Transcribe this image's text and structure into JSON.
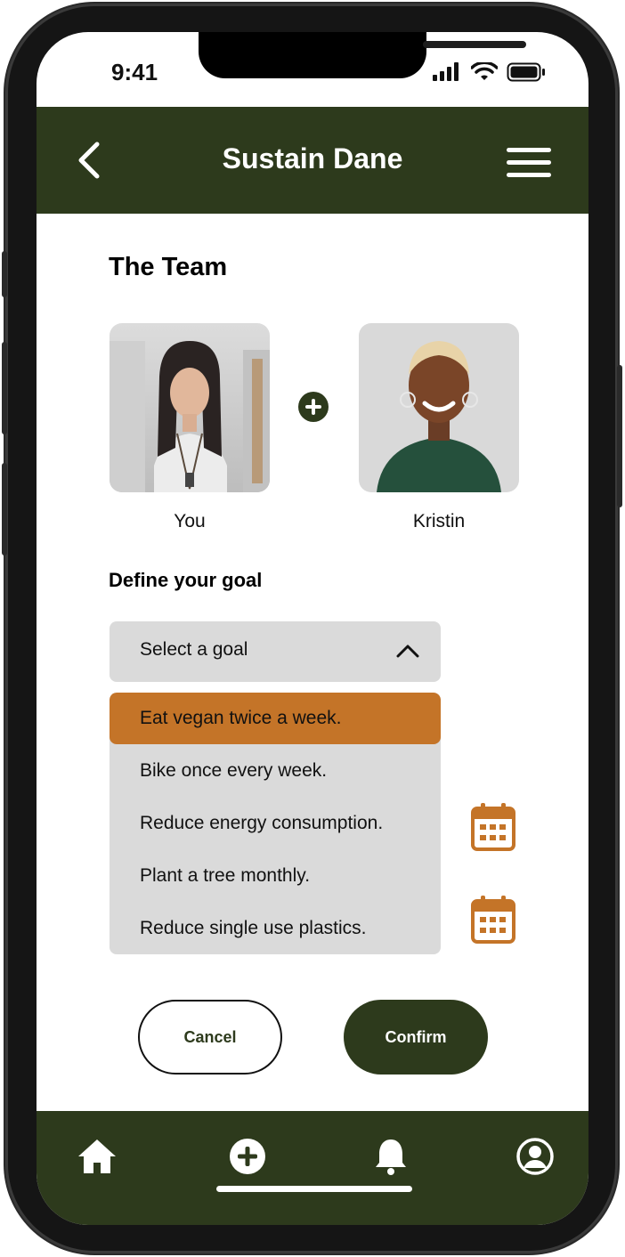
{
  "status_bar": {
    "time": "9:41"
  },
  "header": {
    "title": "Sustain Dane"
  },
  "team": {
    "title": "The Team",
    "members": [
      {
        "name": "You"
      },
      {
        "name": "Kristin"
      }
    ]
  },
  "goal": {
    "label": "Define your goal",
    "select_placeholder": "Select a goal",
    "options": [
      {
        "label": "Eat vegan twice a week.",
        "selected": true
      },
      {
        "label": "Bike once every week.",
        "selected": false
      },
      {
        "label": "Reduce energy consumption.",
        "selected": false
      },
      {
        "label": "Plant a tree monthly.",
        "selected": false
      },
      {
        "label": "Reduce single use plastics.",
        "selected": false
      }
    ]
  },
  "actions": {
    "cancel_label": "Cancel",
    "confirm_label": "Confirm"
  },
  "bottom_nav": [
    "home-icon",
    "add-circle-icon",
    "bell-icon",
    "profile-icon"
  ],
  "colors": {
    "primary": "#2d3a1c",
    "accent": "#c47428",
    "surface": "#dadada"
  }
}
